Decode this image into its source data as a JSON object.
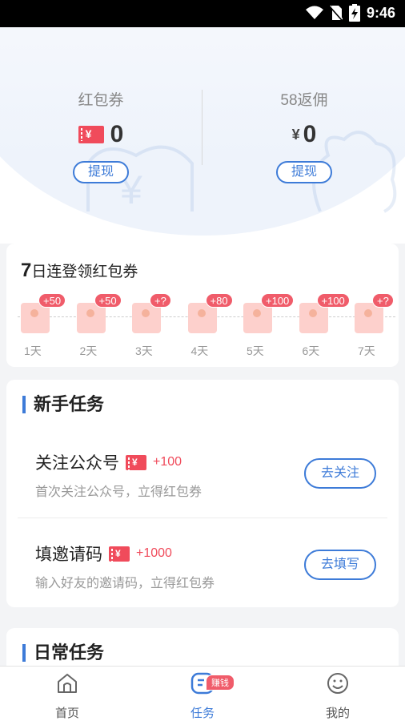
{
  "status_bar": {
    "time": "9:46"
  },
  "balances": {
    "coupon": {
      "label": "红包券",
      "value": "0"
    },
    "rebate": {
      "label": "58返佣",
      "currency": "¥",
      "value": "0"
    },
    "withdraw_label": "提现"
  },
  "signin": {
    "title_num": "7",
    "title_rest": "日连登领红包券",
    "days": [
      {
        "reward": "+50",
        "label": "1天"
      },
      {
        "reward": "+50",
        "label": "2天"
      },
      {
        "reward": "+?",
        "label": "3天"
      },
      {
        "reward": "+80",
        "label": "4天"
      },
      {
        "reward": "+100",
        "label": "5天"
      },
      {
        "reward": "+100",
        "label": "6天"
      },
      {
        "reward": "+?",
        "label": "7天"
      }
    ]
  },
  "novice": {
    "title": "新手任务",
    "tasks": [
      {
        "name": "关注公众号",
        "reward": "+100",
        "desc": "首次关注公众号，立得红包券",
        "action": "去关注"
      },
      {
        "name": "填邀请码",
        "reward": "+1000",
        "desc": "输入好友的邀请码，立得红包券",
        "action": "去填写"
      }
    ]
  },
  "daily": {
    "title": "日常任务"
  },
  "coupon_symbol": "¥",
  "tabbar": {
    "items": [
      {
        "label": "首页",
        "icon": "home-icon"
      },
      {
        "label": "任务",
        "icon": "task-icon",
        "badge": "赚钱"
      },
      {
        "label": "我的",
        "icon": "smile-face-icon"
      }
    ],
    "active_color": "#3d7bd8"
  },
  "colors": {
    "accent": "#3d7bd8",
    "red": "#f04b5b"
  }
}
